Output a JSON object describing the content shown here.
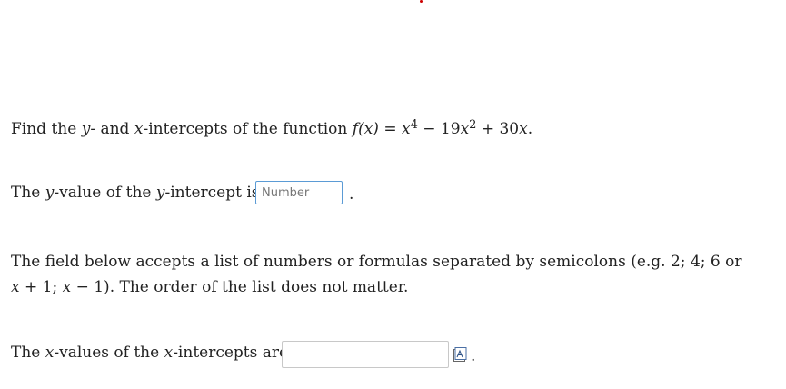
{
  "question": {
    "prefix": "Find the ",
    "var_y": "y",
    "and": "- and ",
    "var_x": "x",
    "suffix": "-intercepts of the function ",
    "func": "f",
    "paren_x": "(x)",
    "equals": " = ",
    "term1_base": "x",
    "term1_exp": "4",
    "minus": " − 19",
    "term2_base": "x",
    "term2_exp": "2",
    "plus": " + 30",
    "term3": "x",
    "end": "."
  },
  "y_intercept": {
    "label_a": "The ",
    "var_y1": "y",
    "label_b": "-value of the ",
    "var_y2": "y",
    "label_c": "-intercept is",
    "placeholder": "Number",
    "value": "",
    "end": "."
  },
  "instructions": {
    "line1_a": "The field below accepts a list of numbers or formulas separated by semicolons (e.g. 2; 4; 6 or",
    "line2_a": "x",
    "line2_b": " + 1;  ",
    "line2_c": "x",
    "line2_d": " − 1). The order of the list does not matter."
  },
  "x_intercepts": {
    "label_a": "The ",
    "var_x1": "x",
    "label_b": "-values of the ",
    "var_x2": "x",
    "label_c": "-intercepts are",
    "value": "",
    "preview_icon": "preview-icon",
    "end": "."
  }
}
